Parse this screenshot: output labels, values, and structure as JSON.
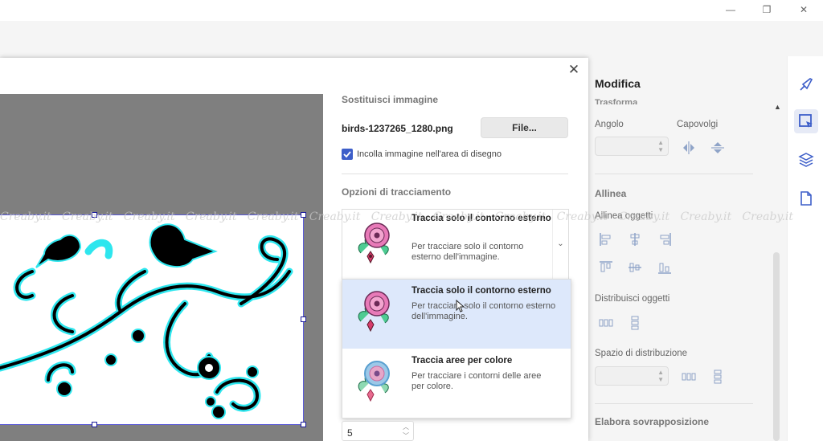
{
  "window": {
    "minimize_glyph": "—",
    "restore_glyph": "❐",
    "close_glyph": "✕"
  },
  "right_panel": {
    "title": "Modifica",
    "subtitle": "Trasforma",
    "angle_label": "Angolo",
    "flip_label": "Capovolgi",
    "align_heading": "Allinea",
    "align_objects_label": "Allinea oggetti",
    "distribute_label": "Distribuisci oggetti",
    "spacing_label": "Spazio di distribuzione",
    "overlap_heading": "Elabora sovrapposizione"
  },
  "right_toolbar": {
    "items": [
      "paintbrush-icon",
      "select-edit-icon",
      "layers-icon",
      "page-icon"
    ]
  },
  "dialog": {
    "close_glyph": "✕",
    "replace_section_title": "Sostituisci immagine",
    "filename": "birds-1237265_1280.png",
    "file_button_label": "File...",
    "paste_checkbox_label": "Incolla immagine nell'area di disegno",
    "paste_checkbox_checked": true,
    "trace_section_title": "Opzioni di tracciamento",
    "selected_option": {
      "title": "Traccia solo il contorno esterno",
      "description": "Per tracciare solo il contorno esterno dell'immagine."
    },
    "options": [
      {
        "title": "Traccia solo il contorno esterno",
        "description": "Per tracciare solo il contorno esterno dell'immagine."
      },
      {
        "title": "Traccia aree per colore",
        "description": "Per tracciare i contorni delle aree per colore."
      }
    ],
    "number_value": "5"
  },
  "watermark": "Creaby.it   Creaby.it   Creaby.it   Creaby.it   Creaby.it   Creaby.it   Creaby.it   Creaby.it   Creaby.it   Creaby.it   Creaby.it   Creaby.it   Creaby.it",
  "colors": {
    "accent": "#3d5ec9",
    "selection": "#5a5ad8",
    "outline": "#2ee6ee",
    "hover": "#dde8fb"
  }
}
